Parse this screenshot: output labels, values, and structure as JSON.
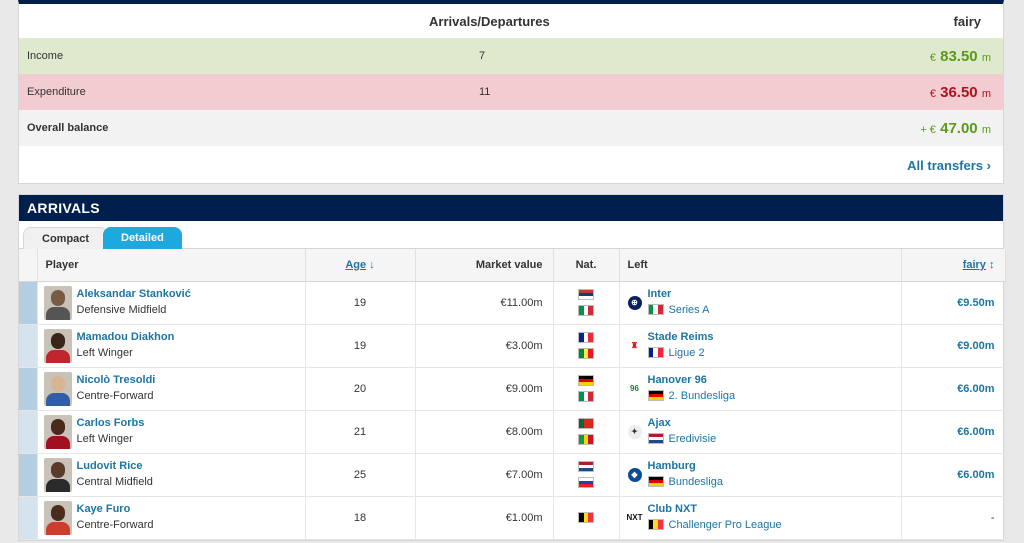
{
  "summary": {
    "title": "Arrivals/Departures",
    "right_label": "fairy",
    "rows": [
      {
        "label": "Income",
        "count": "7",
        "currency": "€",
        "amount": "83.50",
        "unit": "m"
      },
      {
        "label": "Expenditure",
        "count": "11",
        "currency": "€",
        "amount": "36.50",
        "unit": "m"
      },
      {
        "label": "Overall balance",
        "count": "",
        "currency": "+ €",
        "amount": "47.00",
        "unit": "m"
      }
    ],
    "all_transfers": "All transfers",
    "all_transfers_arrow": "›"
  },
  "arrivals": {
    "title": "ARRIVALS",
    "tabs": {
      "compact": "Compact",
      "detailed": "Detailed"
    },
    "columns": {
      "player": "Player",
      "age": "Age",
      "age_sort": "↓",
      "market_value": "Market value",
      "nat": "Nat.",
      "left": "Left",
      "fee": "fairy",
      "fee_sort": "↕"
    },
    "rows": [
      {
        "name": "Aleksandar Stanković",
        "position": "Defensive Midfield",
        "age": "19",
        "market_value": "€11.00m",
        "club": "Inter",
        "league": "Series A",
        "fee": "€9.50m"
      },
      {
        "name": "Mamadou Diakhon",
        "position": "Left Winger",
        "age": "19",
        "market_value": "€3.00m",
        "club": "Stade Reims",
        "league": "Ligue 2",
        "fee": "€9.00m"
      },
      {
        "name": "Nicolò Tresoldi",
        "position": "Centre-Forward",
        "age": "20",
        "market_value": "€9.00m",
        "club": "Hanover 96",
        "league": "2. Bundesliga",
        "fee": "€6.00m"
      },
      {
        "name": "Carlos Forbs",
        "position": "Left Winger",
        "age": "21",
        "market_value": "€8.00m",
        "club": "Ajax",
        "league": "Eredivisie",
        "fee": "€6.00m"
      },
      {
        "name": "Ludovit Rice",
        "position": "Central Midfield",
        "age": "25",
        "market_value": "€7.00m",
        "club": "Hamburg",
        "league": "Bundesliga",
        "fee": "€6.00m"
      },
      {
        "name": "Kaye Furo",
        "position": "Centre-Forward",
        "age": "18",
        "market_value": "€1.00m",
        "club": "Club NXT",
        "league": "Challenger Pro League",
        "fee": "-"
      }
    ]
  },
  "colors": {
    "navy": "#001f4d",
    "link": "#1d75a3",
    "green": "#5a9a1a",
    "red": "#b3101f",
    "tab_active": "#1ea8e0"
  }
}
